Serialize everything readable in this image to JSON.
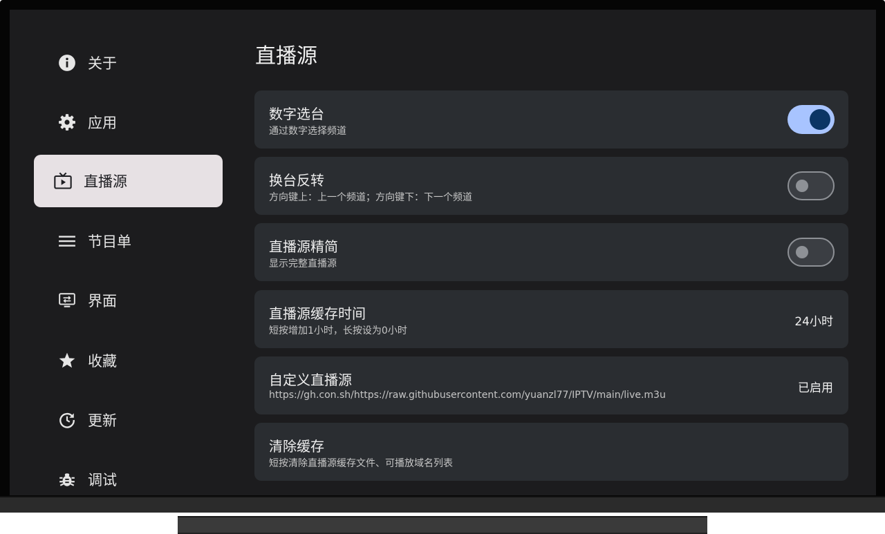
{
  "sidebar": {
    "items": [
      {
        "label": "关于",
        "icon": "info-icon"
      },
      {
        "label": "应用",
        "icon": "gear-icon"
      },
      {
        "label": "直播源",
        "icon": "tv-icon",
        "active": true
      },
      {
        "label": "节目单",
        "icon": "menu-icon"
      },
      {
        "label": "界面",
        "icon": "monitor-icon"
      },
      {
        "label": "收藏",
        "icon": "star-icon"
      },
      {
        "label": "更新",
        "icon": "update-icon"
      },
      {
        "label": "调试",
        "icon": "bug-icon"
      }
    ]
  },
  "main": {
    "title": "直播源",
    "settings": [
      {
        "title": "数字选台",
        "description": "通过数字选择频道",
        "toggle": true
      },
      {
        "title": "换台反转",
        "description": "方向键上：上一个频道；方向键下：下一个频道",
        "toggle": false
      },
      {
        "title": "直播源精简",
        "description": "显示完整直播源",
        "toggle": false
      },
      {
        "title": "直播源缓存时间",
        "description": "短按增加1小时，长按设为0小时",
        "value": "24小时"
      },
      {
        "title": "自定义直播源",
        "description": "https://gh.con.sh/https://raw.githubusercontent.com/yuanzl77/IPTV/main/live.m3u",
        "value": "已启用"
      },
      {
        "title": "清除缓存",
        "description": "短按清除直播源缓存文件、可播放域名列表"
      }
    ]
  },
  "colors": {
    "background": "#1c1c1e",
    "card": "#2a2d31",
    "active_nav": "#e7e1e4",
    "toggle_on_track": "#a8c4ff",
    "toggle_on_knob": "#0b3564"
  }
}
